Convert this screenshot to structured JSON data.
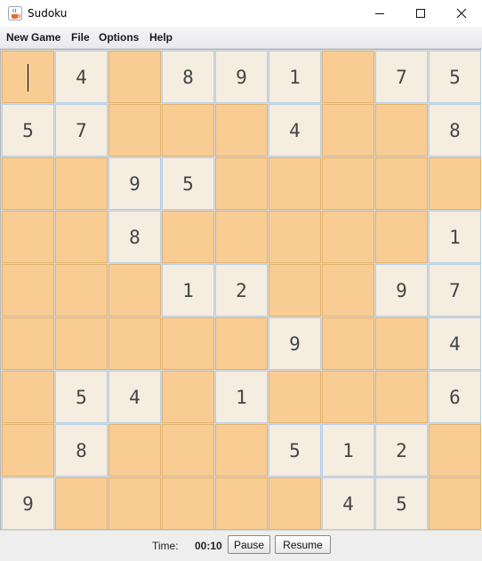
{
  "window": {
    "title": "Sudoku",
    "app_icon": "java-coffee-icon",
    "controls": [
      "minimize-icon",
      "maximize-icon",
      "close-icon"
    ]
  },
  "menu": {
    "items": [
      "New Game",
      "File",
      "Options",
      "Help"
    ]
  },
  "board": {
    "rows": [
      [
        "",
        "4",
        "",
        "8",
        "9",
        "1",
        "",
        "7",
        "5"
      ],
      [
        "5",
        "7",
        "",
        "",
        "",
        "4",
        "",
        "",
        "8"
      ],
      [
        "",
        "",
        "9",
        "5",
        "",
        "",
        "",
        "",
        ""
      ],
      [
        "",
        "",
        "8",
        "",
        "",
        "",
        "",
        "",
        "1"
      ],
      [
        "",
        "",
        "",
        "1",
        "2",
        "",
        "",
        "9",
        "7"
      ],
      [
        "",
        "",
        "",
        "",
        "",
        "9",
        "",
        "",
        "4"
      ],
      [
        "",
        "5",
        "4",
        "",
        "1",
        "",
        "",
        "",
        "6"
      ],
      [
        "",
        "8",
        "",
        "",
        "",
        "5",
        "1",
        "2",
        ""
      ],
      [
        "9",
        "",
        "",
        "",
        "",
        "",
        "4",
        "5",
        ""
      ]
    ],
    "selected_cell": "r1c1",
    "colors": {
      "given_cell": "#f5ede0",
      "empty_cell": "#f9cc93",
      "given_border": "#b8d0ea"
    }
  },
  "status": {
    "time_label": "Time:",
    "time_value": "00:10",
    "pause_label": "Pause",
    "resume_label": "Resume"
  }
}
